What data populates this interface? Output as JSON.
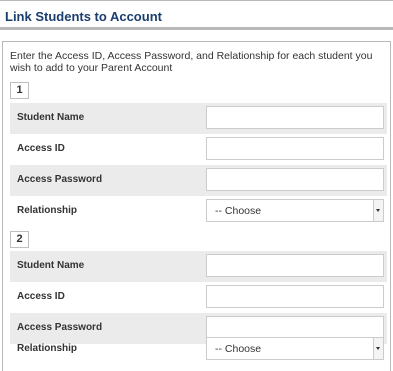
{
  "title": "Link Students to Account",
  "intro": "Enter the Access ID, Access Password, and Relationship for each student you wish to add to your Parent Account",
  "students": [
    {
      "number": "1",
      "fields": {
        "student_name": {
          "label": "Student Name",
          "value": ""
        },
        "access_id": {
          "label": "Access ID",
          "value": ""
        },
        "access_password": {
          "label": "Access Password",
          "value": ""
        },
        "relationship": {
          "label": "Relationship",
          "selected": "-- Choose"
        }
      }
    },
    {
      "number": "2",
      "fields": {
        "student_name": {
          "label": "Student Name",
          "value": ""
        },
        "access_id": {
          "label": "Access ID",
          "value": ""
        },
        "access_password": {
          "label": "Access Password",
          "value": ""
        },
        "relationship": {
          "label": "Relationship",
          "selected": "-- Choose"
        }
      }
    }
  ],
  "icons": {
    "select_arrow": "chevron-down-icon"
  }
}
